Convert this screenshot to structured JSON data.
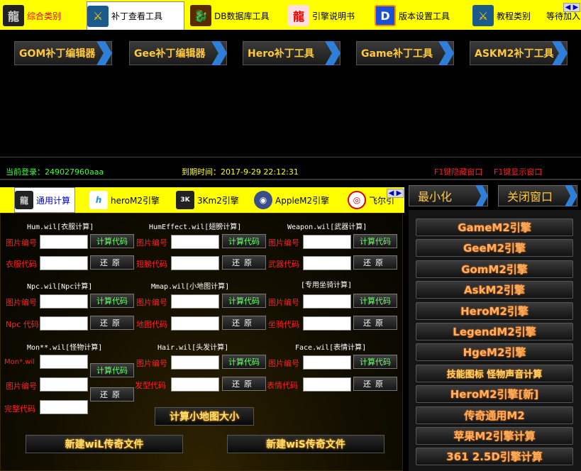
{
  "top_tabs": [
    {
      "label": "综合类别",
      "icon": "dragon-logo-icon",
      "selected": true
    },
    {
      "label": "补丁查看工具",
      "icon": "mir-emblem-icon",
      "active": true
    },
    {
      "label": "DB数据库工具",
      "icon": "dragon-figure-icon"
    },
    {
      "label": "引擎说明书",
      "icon": "red-dragon-icon"
    },
    {
      "label": "版本设置工具",
      "icon": "d-letter-icon"
    },
    {
      "label": "教程类别",
      "icon": "mir-emblem-icon"
    },
    {
      "label": "等待加入",
      "icon": ""
    }
  ],
  "patch_buttons": [
    "GOM补丁编辑器",
    "Gee补丁编辑器",
    "Hero补丁工具",
    "Game补丁工具",
    "ASKM2补丁工具"
  ],
  "status": {
    "login": "当前登录：249027960aaa",
    "expire": "到期时间：2017-9-29 22:12:31",
    "hide_hint": "F1键隐藏窗口",
    "show_hint": "F1键显示窗口"
  },
  "bottom_tabs": [
    {
      "label": "通用计算",
      "icon": "dragon-logo-icon",
      "active": true
    },
    {
      "label": "heroM2引擎",
      "icon": "h-letter-icon"
    },
    {
      "label": "3Km2引擎",
      "icon": "3km2-icon"
    },
    {
      "label": "AppleM2引擎",
      "icon": "apple-icon"
    },
    {
      "label": "飞尔引",
      "icon": "red-swirl-icon"
    }
  ],
  "window_controls": {
    "minimize": "最小化",
    "close": "关闭窗口"
  },
  "calc": {
    "hum_header": "Hum.wil[衣服计算]",
    "humeffect_header": "HumEffect.wil[翅膀计算]",
    "weapon_header": "Weapon.wil[武器计算]",
    "npc_header": "Npc.wil[Npc计算]",
    "mmap_header": "Mmap.wil[小地图计算]",
    "mount_header": "[专用坐骑计算]",
    "mon_header": "Mon**.wil[怪物计算]",
    "hair_header": "Hair.wil[头发计算]",
    "face_header": "Face.wil[表情计算]",
    "lbl_pic": "图片编号",
    "lbl_cloth": "衣服代码",
    "lbl_wing": "翅膀代码",
    "lbl_weapon": "武器代码",
    "lbl_npc": "Npc 代码",
    "lbl_map": "地图代码",
    "lbl_mount": "坐骑代码",
    "lbl_monwil": "Mon*.wil",
    "lbl_hair": "发型代码",
    "lbl_face": "表情代码",
    "lbl_full": "完整代码",
    "btn_calc": "计算代码",
    "btn_restore": "还原",
    "btn_minimap": "计算小地图大小",
    "btn_new_wil": "新建wiL传奇文件",
    "btn_new_wis": "新建wiS传奇文件"
  },
  "engines": [
    "GameM2引擎",
    "GeeM2引擎",
    "GomM2引擎",
    "AskM2引擎",
    "HeroM2引擎",
    "LegendM2引擎",
    "HgeM2引擎",
    "技能图标 怪物声音计算",
    "HeroM2引擎[新]",
    "传奇通用M2",
    "苹果M2引擎计算",
    "361 2.5D引擎计算"
  ]
}
